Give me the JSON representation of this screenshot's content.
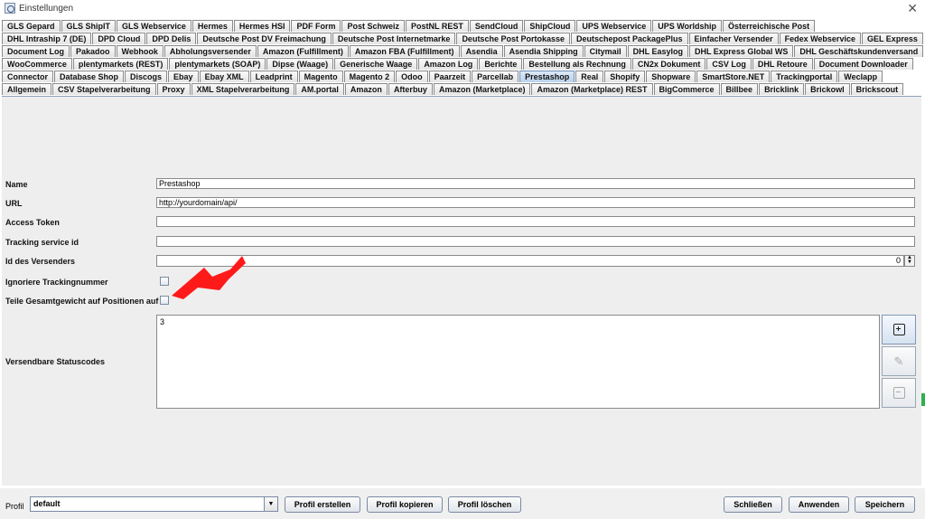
{
  "window": {
    "title": "Einstellungen",
    "close_glyph": "✕",
    "app_icon": "settings-app-icon",
    "close_icon": "close-icon"
  },
  "tabs": {
    "rows": [
      [
        "GLS Gepard",
        "GLS ShipIT",
        "GLS Webservice",
        "Hermes",
        "Hermes HSI",
        "PDF Form",
        "Post Schweiz",
        "PostNL REST",
        "SendCloud",
        "ShipCloud",
        "UPS Webservice",
        "UPS Worldship",
        "Österreichische Post"
      ],
      [
        "DHL Intraship 7 (DE)",
        "DPD Cloud",
        "DPD Delis",
        "Deutsche Post DV Freimachung",
        "Deutsche Post Internetmarke",
        "Deutsche Post Portokasse",
        "Deutschepost PackagePlus",
        "Einfacher Versender",
        "Fedex Webservice",
        "GEL Express"
      ],
      [
        "Document Log",
        "Pakadoo",
        "Webhook",
        "Abholungsversender",
        "Amazon (Fulfillment)",
        "Amazon FBA (Fulfillment)",
        "Asendia",
        "Asendia Shipping",
        "Citymail",
        "DHL Easylog",
        "DHL Express Global WS",
        "DHL Geschäftskundenversand"
      ],
      [
        "WooCommerce",
        "plentymarkets (REST)",
        "plentymarkets (SOAP)",
        "Dipse (Waage)",
        "Generische Waage",
        "Amazon Log",
        "Berichte",
        "Bestellung als Rechnung",
        "CN2x Dokument",
        "CSV Log",
        "DHL Retoure",
        "Document Downloader"
      ],
      [
        "Connector",
        "Database Shop",
        "Discogs",
        "Ebay",
        "Ebay XML",
        "Leadprint",
        "Magento",
        "Magento 2",
        "Odoo",
        "Paarzeit",
        "Parcellab",
        "Prestashop",
        "Real",
        "Shopify",
        "Shopware",
        "SmartStore.NET",
        "Trackingportal",
        "Weclapp"
      ],
      [
        "Allgemein",
        "CSV Stapelverarbeitung",
        "Proxy",
        "XML Stapelverarbeitung",
        "AM.portal",
        "Amazon",
        "Afterbuy",
        "Amazon (Marketplace)",
        "Amazon (Marketplace) REST",
        "BigCommerce",
        "Billbee",
        "Bricklink",
        "Brickowl",
        "Brickscout"
      ]
    ],
    "selected": "Prestashop"
  },
  "form": {
    "name_label": "Name",
    "name_value": "Prestashop",
    "url_label": "URL",
    "url_value": "http://yourdomain/api/",
    "token_label": "Access Token",
    "token_value": "",
    "tracking_label": "Tracking service id",
    "tracking_value": "",
    "sender_label": "Id des Versenders",
    "sender_value": "0",
    "ignore_label": "Ignoriere Trackingnummer",
    "split_label": "Teile Gesamtgewicht auf Positionen auf",
    "status_label": "Versendbare Statuscodes",
    "status_value": "3",
    "add_icon": "add-icon",
    "edit_icon": "edit-icon",
    "remove_icon": "remove-icon"
  },
  "annotation": {
    "arrow_color": "#ff1a1a"
  },
  "footer": {
    "profil_label": "Profil",
    "profil_value": "default",
    "create_label": "Profil erstellen",
    "copy_label": "Profil kopieren",
    "delete_label": "Profil löschen",
    "close_label": "Schließen",
    "apply_label": "Anwenden",
    "save_label": "Speichern"
  },
  "colors": {
    "panel_bg": "#eeeeee",
    "selected_tab": "#c8dbf1",
    "status_green": "#2bb24c"
  }
}
